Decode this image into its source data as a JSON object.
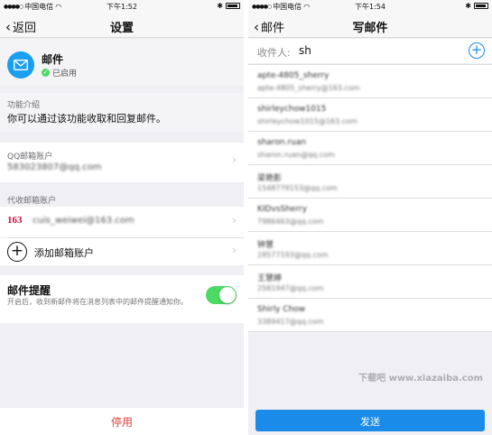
{
  "colors": {
    "accent_blue": "#1a9ef0",
    "toggle_green": "#4cd964",
    "danger_red": "#e0443e",
    "send_blue": "#1a8be8"
  },
  "left": {
    "status": {
      "carrier": "中国电信",
      "time": "下午1:52"
    },
    "nav": {
      "back_label": "返回",
      "title": "设置"
    },
    "app": {
      "name": "邮件",
      "status": "已启用"
    },
    "intro": {
      "heading": "功能介绍",
      "text": "你可以通过该功能收取和回复邮件。"
    },
    "qq": {
      "label": "QQ邮箱账户",
      "value": "583023807@qq.com"
    },
    "other": {
      "label": "代收邮箱账户",
      "badge": "163",
      "account": "cuis_weiwei@163.com",
      "add_label": "添加邮箱账户"
    },
    "notify": {
      "title": "邮件提醒",
      "desc": "开启后，收到新邮件将在消息列表中的邮件提醒通知你。",
      "enabled": true
    },
    "disable_label": "停用"
  },
  "right": {
    "status": {
      "carrier": "中国电信",
      "time": "下午1:54"
    },
    "nav": {
      "back_label": "邮件",
      "title": "写邮件"
    },
    "recipient": {
      "label": "收件人:",
      "value": "sh"
    },
    "contacts": [
      {
        "name": "apte-4805_sherry",
        "email": "apte-4805_sherry@163.com"
      },
      {
        "name": "shirleychow1015",
        "email": "shirleychow1015@163.com"
      },
      {
        "name": "sharon.ruan",
        "email": "sharon.ruan@qq.com"
      },
      {
        "name": "梁艳影",
        "email": "1548779153@qq.com"
      },
      {
        "name": "KIDvsSherry",
        "email": "7986463@qq.com"
      },
      {
        "name": "钟慧",
        "email": "28577193@qq.com"
      },
      {
        "name": "王慧婷",
        "email": "2581947@qq.com"
      },
      {
        "name": "Shirly Chow",
        "email": "3389417@qq.com"
      }
    ],
    "send_label": "发送"
  },
  "watermark": "下载吧 www.xiazaiba.com"
}
